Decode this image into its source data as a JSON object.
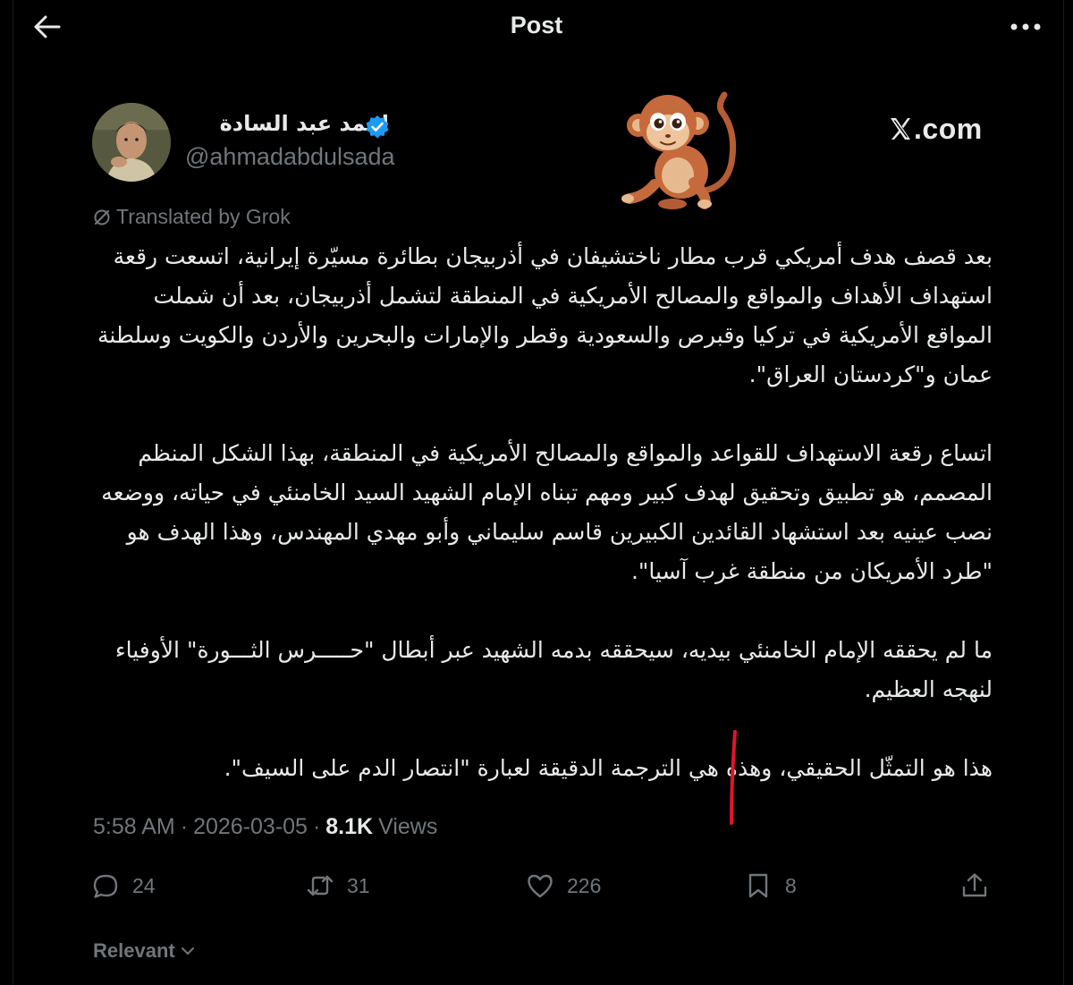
{
  "header": {
    "title": "Post",
    "back_icon": "arrow-left-icon",
    "more_icon": "more-horizontal-icon"
  },
  "author": {
    "name": "احمد عبد السادة",
    "handle": "@ahmadabdulsada",
    "verified_color": "#1d9bf0"
  },
  "watermark": {
    "site": ".com",
    "mascot_icon": "monkey-icon"
  },
  "translation": {
    "label": "Translated by Grok"
  },
  "post": {
    "paragraphs": [
      "بعد قصف هدف أمريكي قرب مطار ناختشيفان في أذربيجان بطائرة مسيّرة إيرانية، اتسعت رقعة استهداف الأهداف والمواقع والمصالح الأمريكية في المنطقة لتشمل أذربيجان، بعد أن شملت المواقع الأمريكية في تركيا وقبرص والسعودية وقطر والإمارات والبحرين والأردن والكويت وسلطنة عمان و\"كردستان العراق\".",
      "اتساع رقعة الاستهداف للقواعد والمواقع والمصالح الأمريكية في المنطقة، بهذا الشكل المنظم المصمم، هو تطبيق وتحقيق لهدف كبير ومهم تبناه الإمام الشهيد السيد الخامنئي في حياته، ووضعه نصب عينيه بعد استشهاد القائدين الكبيرين قاسم سليماني وأبو مهدي المهندس، وهذا الهدف هو \"طرد الأمريكان من منطقة غرب آسيا\".",
      "ما لم يحققه الإمام الخامنئي بيديه، سيحققه بدمه الشهيد عبر أبطال \"حـــــرس الثـــورة\" الأوفياء لنهجه العظيم.",
      "هذا هو التمثّل الحقيقي، وهذه هي الترجمة الدقيقة لعبارة \"انتصار الدم على السيف\"."
    ]
  },
  "meta": {
    "time": "5:58 AM",
    "date": "2026-03-05",
    "separator": "·",
    "views_count": "8.1K",
    "views_label": "Views"
  },
  "actions": {
    "replies": "24",
    "reposts": "31",
    "likes": "226",
    "bookmarks": "8"
  },
  "sort": {
    "label": "Relevant"
  },
  "colors": {
    "background": "#000000",
    "text": "#e7e9ea",
    "muted": "#71767b",
    "accent": "#1d9bf0",
    "annotation": "#e0142e"
  }
}
